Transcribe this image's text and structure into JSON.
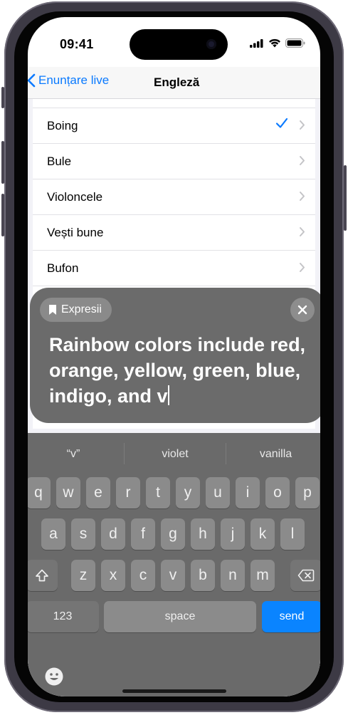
{
  "status_bar": {
    "time": "09:41"
  },
  "nav": {
    "back_label": "Enunțare live",
    "title": "Engleză"
  },
  "sound_list": {
    "items": [
      {
        "label": "Boing",
        "selected": true
      },
      {
        "label": "Bule",
        "selected": false
      },
      {
        "label": "Violoncele",
        "selected": false
      },
      {
        "label": "Vești bune",
        "selected": false
      },
      {
        "label": "Bufon",
        "selected": false
      }
    ]
  },
  "panel": {
    "chip_label": "Expresii",
    "phrase_text": "Rainbow colors include red, orange, yellow, green, blue, indigo, and v"
  },
  "keyboard": {
    "suggestions": [
      "“v”",
      "violet",
      "vanilla"
    ],
    "row1": [
      "q",
      "w",
      "e",
      "r",
      "t",
      "y",
      "u",
      "i",
      "o",
      "p"
    ],
    "row2": [
      "a",
      "s",
      "d",
      "f",
      "g",
      "h",
      "j",
      "k",
      "l"
    ],
    "row3": [
      "z",
      "x",
      "c",
      "v",
      "b",
      "n",
      "m"
    ],
    "numbers_label": "123",
    "space_label": "space",
    "send_label": "send"
  },
  "colors": {
    "accent": "#0a7aff",
    "send": "#0a84ff",
    "panel": "#6b6b6b"
  }
}
